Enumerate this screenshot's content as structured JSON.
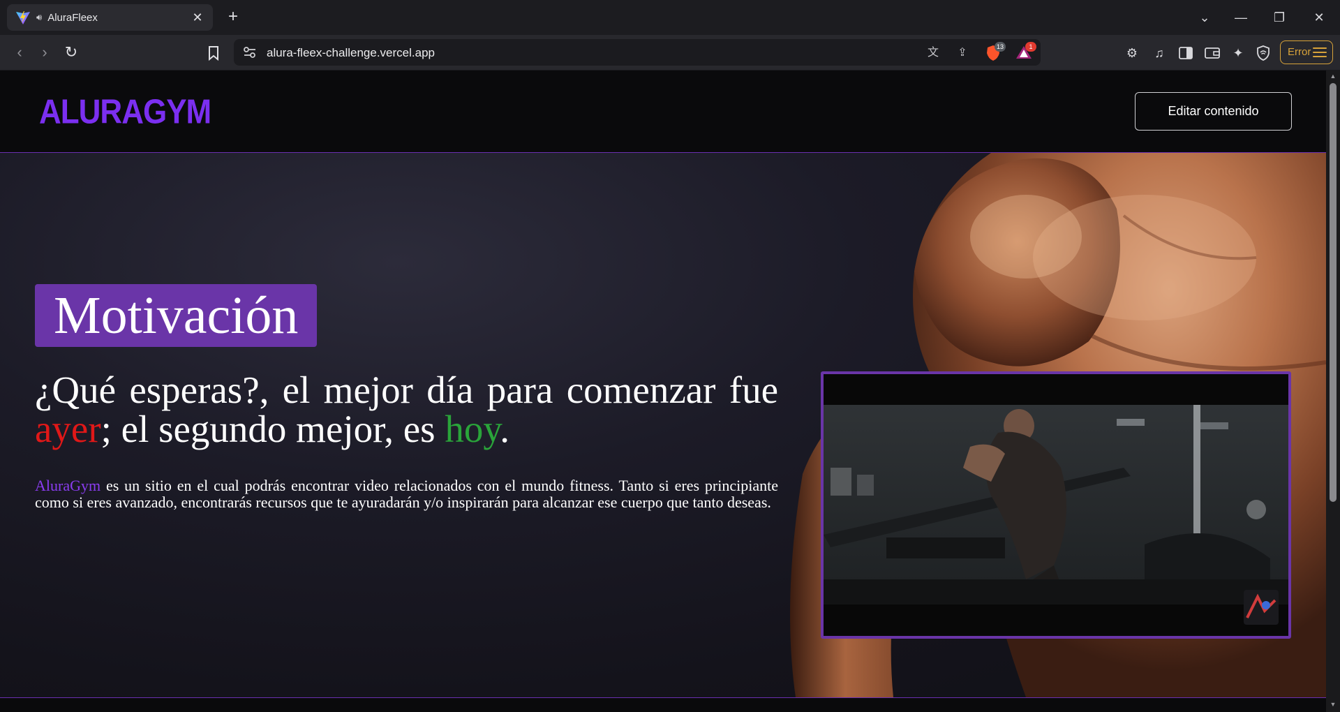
{
  "browser": {
    "tab_title": "AluraFleex",
    "new_tab": "+",
    "url": "alura-fleex-challenge.vercel.app",
    "shield_count": "13",
    "alert_count": "1",
    "error_label": "Error"
  },
  "header": {
    "logo": "ALURAGYM",
    "edit_button": "Editar contenido"
  },
  "hero": {
    "category": "Motivación",
    "headline_part1": "¿Qué esperas?, el mejor día para comenzar fue ",
    "headline_red": "ayer",
    "headline_part2": "; el segundo mejor, es ",
    "headline_green": "hoy",
    "headline_end": ".",
    "description_brand": "AluraGym",
    "description_text": " es un sitio en el cual podrás encontrar video relacionados con el mundo fitness. Tanto si eres principiante como si eres avanzado, encontrarás recursos que te ayuradarán y/o inspirarán para alcanzar ese cuerpo que tanto deseas."
  },
  "colors": {
    "accent": "#6a35a8",
    "logo": "#7b2ff0",
    "brand_text": "#8a3cf0",
    "red": "#e01818",
    "green": "#2aa43a",
    "error": "#d8a33a"
  }
}
